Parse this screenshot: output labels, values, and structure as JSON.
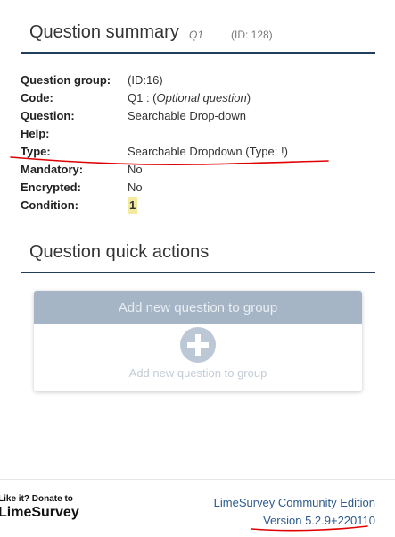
{
  "summary": {
    "title": "Question summary",
    "code": "Q1",
    "id_text": "(ID: 128)",
    "rows": [
      {
        "label": "Question group:",
        "value": "(ID:16)"
      },
      {
        "label": "Code:",
        "value_prefix": "Q1 : (",
        "value_italic": "Optional question",
        "value_suffix": ")"
      },
      {
        "label": "Question:",
        "value": "Searchable Drop-down"
      },
      {
        "label": "Help:",
        "value": ""
      },
      {
        "label": "Type:",
        "value": "Searchable Dropdown (Type: !)"
      },
      {
        "label": "Mandatory:",
        "value": "No"
      },
      {
        "label": "Encrypted:",
        "value": "No"
      },
      {
        "label": "Condition:",
        "value": "1"
      }
    ]
  },
  "quick_actions": {
    "title": "Question quick actions",
    "card_header": "Add new question to group",
    "card_label": "Add new question to group",
    "icon": "plus-circle-icon"
  },
  "footer": {
    "donate_line": "Like it? Donate to",
    "donate_brand": "LimeSurvey",
    "edition": "LimeSurvey Community Edition",
    "version": "Version 5.2.9+220110"
  },
  "annotations": {
    "stroke_color": "#e00000"
  },
  "colors": {
    "header_rule": "#233d5c",
    "card_header_bg": "#a6b5c6",
    "link": "#2c5a8f",
    "condition_badge_bg": "#f2ea9c"
  }
}
